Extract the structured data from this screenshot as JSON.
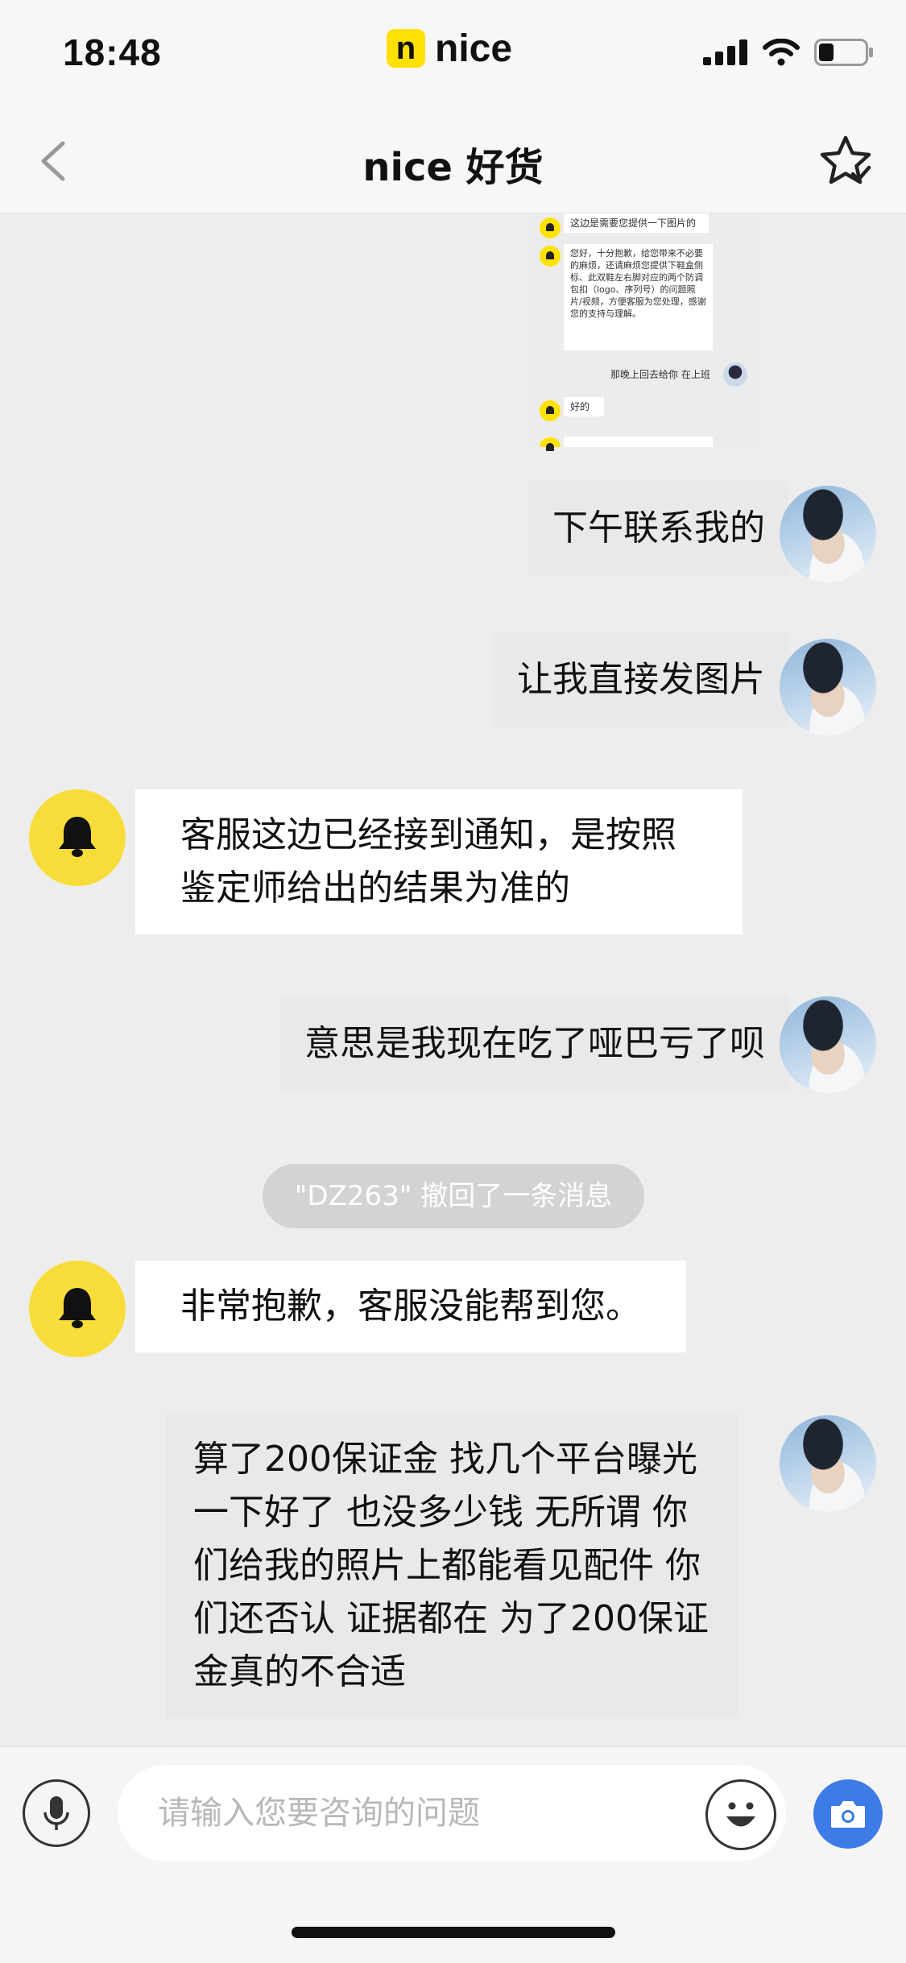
{
  "status_bar": {
    "time": "18:48",
    "brand_badge": "n",
    "brand_name": "nice"
  },
  "nav": {
    "title": "nice 好货"
  },
  "screenshot_preview": {
    "messages": [
      "这边是需要您提供一下图片的",
      "您好，十分抱歉，给您带来不必要的麻烦，还请麻烦您提供下鞋盒侧标、此双鞋左右脚对应的两个防调包扣（logo、序列号）的问题照片/视频，方便客服为您处理，感谢您的支持与理解。",
      "那晚上回去给你 在上班",
      "好的"
    ]
  },
  "messages": [
    {
      "sender": "user",
      "text": "下午联系我的"
    },
    {
      "sender": "user",
      "text": "让我直接发图片"
    },
    {
      "sender": "service",
      "text": "客服这边已经接到通知，是按照鉴定师给出的结果为准的"
    },
    {
      "sender": "user",
      "text": "意思是我现在吃了哑巴亏了呗"
    },
    {
      "sender": "service",
      "text": "非常抱歉，客服没能帮到您。"
    },
    {
      "sender": "user",
      "text": "算了200保证金 找几个平台曝光一下好了 也没多少钱 无所谓 你们给我的照片上都能看见配件 你们还否认 证据都在 为了200保证金真的不合适"
    }
  ],
  "recall_notice": "\"DZ263\" 撤回了一条消息",
  "input": {
    "placeholder": "请输入您要咨询的问题",
    "value": ""
  },
  "icons": {
    "back": "chevron-left-icon",
    "favorite": "star-check-icon",
    "mic": "microphone-icon",
    "emoji": "smiley-icon",
    "camera": "camera-icon",
    "bell": "bell-icon",
    "signal": "signal-icon",
    "wifi": "wifi-icon",
    "battery": "battery-icon"
  },
  "colors": {
    "brand_yellow": "#ffe000",
    "service_avatar": "#f8dd3a",
    "camera_button": "#3d7be8",
    "recall_pill": "#d3d3d3"
  }
}
